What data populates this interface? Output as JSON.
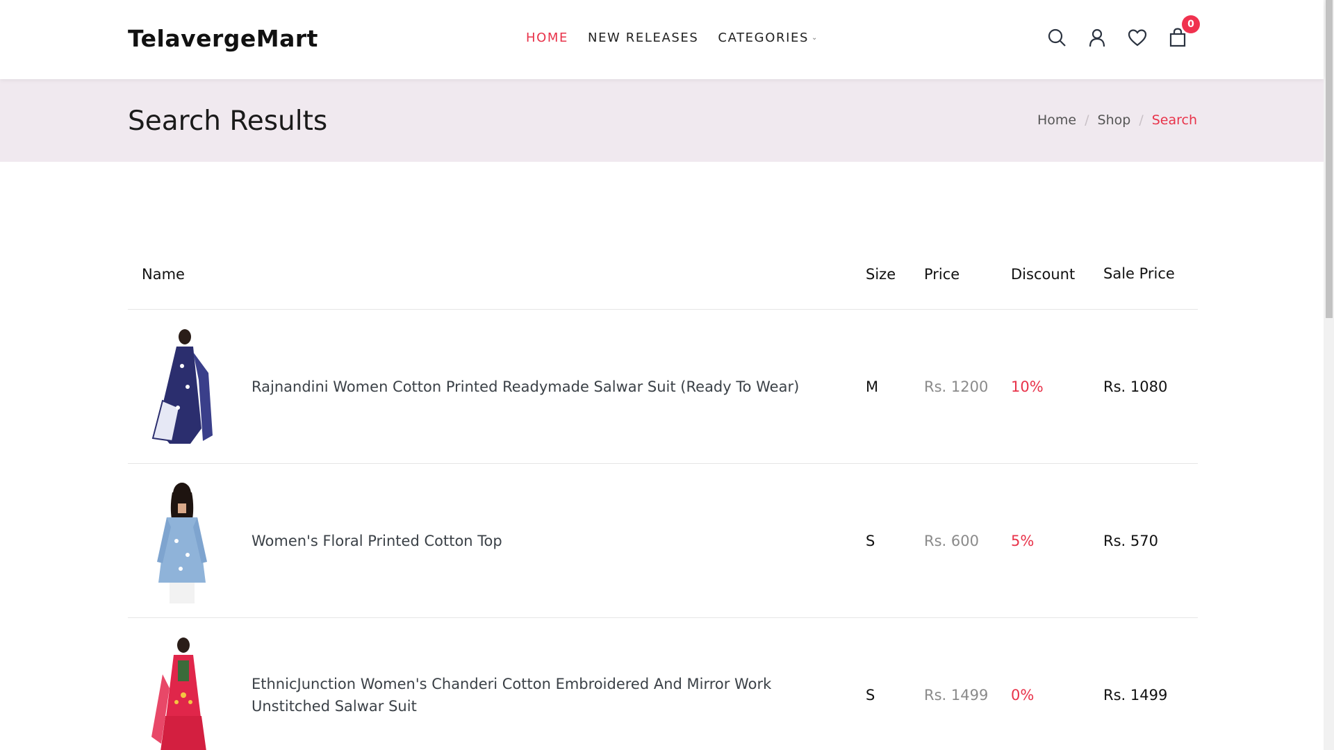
{
  "header": {
    "logo": "TelavergeMart",
    "nav": [
      {
        "label": "HOME",
        "active": true
      },
      {
        "label": "NEW RELEASES",
        "active": false
      },
      {
        "label": "CATEGORIES",
        "active": false
      }
    ],
    "cart_count": "0",
    "accent_color": "#e8334a"
  },
  "banner": {
    "title": "Search Results",
    "breadcrumb": [
      "Home",
      "Shop",
      "Search"
    ]
  },
  "table": {
    "columns": [
      "Name",
      "Size",
      "Price",
      "Discount",
      "Sale Price"
    ],
    "rows": [
      {
        "name": "Rajnandini Women Cotton Printed Readymade Salwar Suit (Ready To Wear)",
        "size": "M",
        "price": "Rs. 1200",
        "discount": "10%",
        "sale_price": "Rs. 1080",
        "thumb_color": "#2b2e6e"
      },
      {
        "name": "Women's Floral Printed Cotton Top",
        "size": "S",
        "price": "Rs. 600",
        "discount": "5%",
        "sale_price": "Rs. 570",
        "thumb_color": "#8fb3d9"
      },
      {
        "name": "EthnicJunction Women's Chanderi Cotton Embroidered And Mirror Work Unstitched Salwar Suit",
        "size": "S",
        "price": "Rs. 1499",
        "discount": "0%",
        "sale_price": "Rs. 1499",
        "thumb_color": "#e0264a"
      }
    ]
  }
}
